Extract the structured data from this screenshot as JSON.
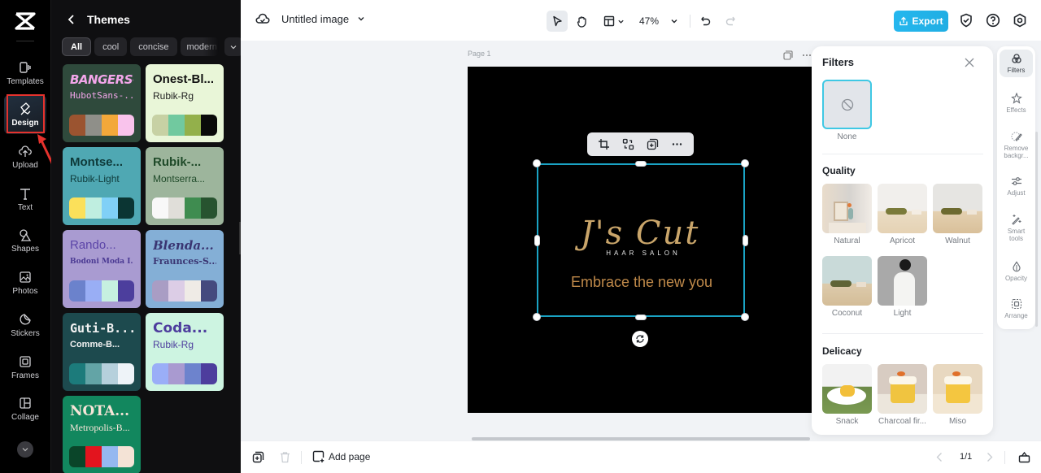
{
  "rail": {
    "items": [
      {
        "label": "Templates",
        "icon": "templates-icon"
      },
      {
        "label": "Design",
        "icon": "design-icon",
        "active": true
      },
      {
        "label": "Upload",
        "icon": "upload-icon"
      },
      {
        "label": "Text",
        "icon": "text-icon"
      },
      {
        "label": "Shapes",
        "icon": "shapes-icon"
      },
      {
        "label": "Photos",
        "icon": "photos-icon"
      },
      {
        "label": "Stickers",
        "icon": "stickers-icon"
      },
      {
        "label": "Frames",
        "icon": "frames-icon"
      },
      {
        "label": "Collage",
        "icon": "collage-icon"
      }
    ]
  },
  "themes": {
    "title": "Themes",
    "chips": [
      "All",
      "cool",
      "concise",
      "modern"
    ],
    "cards": [
      {
        "title": "BANGERS-...",
        "subtitle": "HubotSans-...",
        "bg": "#2f4a3c",
        "c1": "#f3a6ea",
        "c2": "#f3a6ea",
        "colors": [
          "#9b5430",
          "#8f8f89",
          "#f3a83a",
          "#f9c3ec"
        ]
      },
      {
        "title": "Onest-Bl...",
        "subtitle": "Rubik-Rg",
        "bg": "#e9f6d8",
        "c1": "#111111",
        "c2": "#222222",
        "colors": [
          "#c7d1a4",
          "#71c99f",
          "#93b04b",
          "#0a0a0a"
        ]
      },
      {
        "title": "Montse...",
        "subtitle": "Rubik-Light",
        "bg": "#4fa8b3",
        "c1": "#0e3a3a",
        "c2": "#0e3a3a",
        "colors": [
          "#fbe05a",
          "#bfeee0",
          "#80d0f7",
          "#0b3533"
        ]
      },
      {
        "title": "Rubik-...",
        "subtitle": "Montserra...",
        "bg": "#9db59c",
        "c1": "#1f4a29",
        "c2": "#1f4a29",
        "colors": [
          "#f8f8f8",
          "#e0ded9",
          "#3f8c50",
          "#27532f"
        ]
      },
      {
        "title": "Rando...",
        "subtitle": "Bodoni Moda I...",
        "bg": "#a99bd1",
        "c1": "#5b44a8",
        "c2": "#4b3a93",
        "colors": [
          "#6b82cc",
          "#99aef5",
          "#c6f0e0",
          "#4c3e9d"
        ]
      },
      {
        "title": "Blenda...",
        "subtitle": "Fraunces-S...",
        "bg": "#84afd6",
        "c1": "#3a3572",
        "c2": "#3a3572",
        "colors": [
          "#a99dc4",
          "#dccde6",
          "#efebe6",
          "#454a7e"
        ]
      },
      {
        "title": "Guti-B...",
        "subtitle": "Comme-B...",
        "bg": "#1d4a4e",
        "c1": "#f2f2f2",
        "c2": "#f2f2f2",
        "colors": [
          "#1c7b7b",
          "#63a4a6",
          "#b6d0dc",
          "#eef3f8"
        ]
      },
      {
        "title": "Coda...",
        "subtitle": "Rubik-Rg",
        "bg": "#cdf4e1",
        "c1": "#4d3d9d",
        "c2": "#4d3d9d",
        "colors": [
          "#9aaef7",
          "#a99ad0",
          "#6d83cd",
          "#4d3d9d"
        ]
      },
      {
        "title": "NOTA...",
        "subtitle": "Metropolis-B...",
        "bg": "#12875e",
        "c1": "#f7e5d8",
        "c2": "#f7e5d8",
        "colors": [
          "#0a4529",
          "#e3141e",
          "#95b8f0",
          "#f4e3d6"
        ]
      }
    ]
  },
  "topbar": {
    "doc_title": "Untitled image",
    "zoom": "47%",
    "export_label": "Export"
  },
  "canvas": {
    "page_label": "Page 1",
    "logo_text": "J's Cut",
    "logo_sub": "HAAR SALON",
    "tagline": "Embrace the new you"
  },
  "filters": {
    "title": "Filters",
    "none_label": "None",
    "sections": [
      {
        "title": "Quality",
        "items": [
          "Natural",
          "Apricot",
          "Walnut",
          "Coconut",
          "Light"
        ]
      },
      {
        "title": "Delicacy",
        "items": [
          "Snack",
          "Charcoal fir...",
          "Miso"
        ]
      }
    ]
  },
  "rtools": [
    {
      "label": "Filters",
      "active": true
    },
    {
      "label": "Effects"
    },
    {
      "label": "Remove backgr..."
    },
    {
      "label": "Adjust"
    },
    {
      "label": "Smart tools"
    },
    {
      "label": "Opacity"
    },
    {
      "label": "Arrange"
    }
  ],
  "bottombar": {
    "add_page": "Add page",
    "pager": "1/1"
  },
  "colors": {
    "accent": "#1aa3c4",
    "export": "#25b7ee",
    "highlight": "#e5322d"
  }
}
